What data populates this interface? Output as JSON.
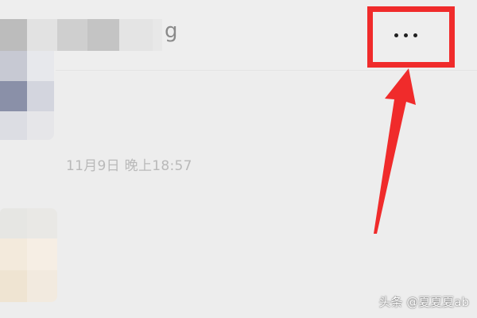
{
  "chat": {
    "header_name_suffix": "g",
    "timestamp": "11月9日 晚上18:57"
  },
  "toolbar": {
    "more_icon": "more-horizontal-dots"
  },
  "annotation": {
    "highlight_color": "#f02b2b"
  },
  "watermark": {
    "text": "头条 @夏夏夏ab"
  }
}
